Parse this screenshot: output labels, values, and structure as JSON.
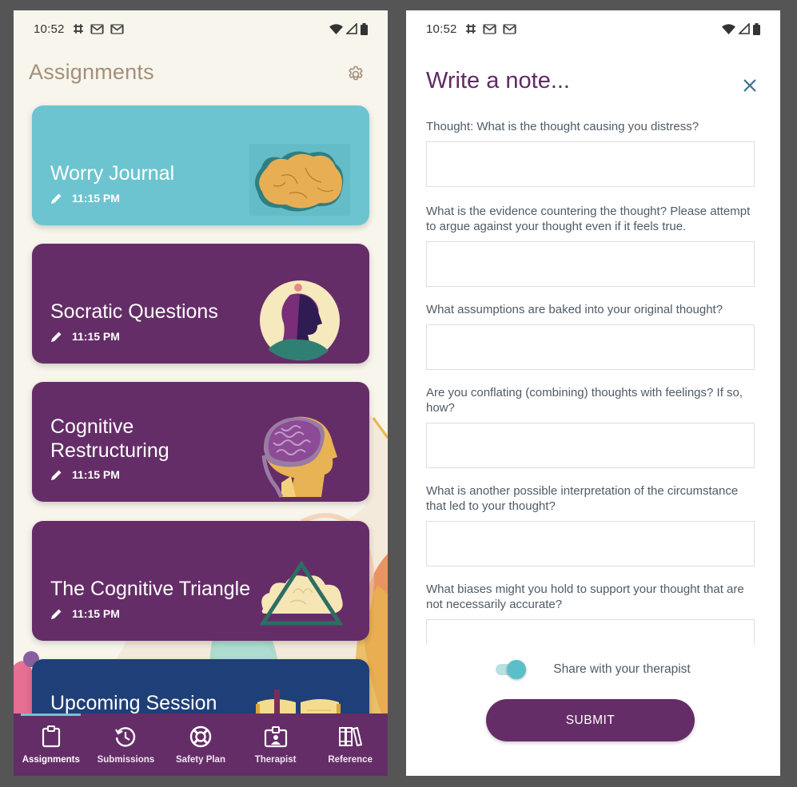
{
  "status_bar": {
    "time": "10:52",
    "notification_icons": [
      "slack-icon",
      "gmail-icon",
      "gmail-icon"
    ],
    "system_icons": [
      "wifi-icon",
      "cell-signal-icon",
      "battery-icon"
    ]
  },
  "assignments_screen": {
    "title": "Assignments",
    "settings_icon": "gear-icon",
    "cards": [
      {
        "title": "Worry Journal",
        "time": "11:15 PM",
        "icon": "pencil-icon",
        "illustration": "brain-cloud",
        "color": "#6cc4d0"
      },
      {
        "title": "Socratic Questions",
        "time": "11:15 PM",
        "icon": "pencil-icon",
        "illustration": "head-silhouette",
        "color": "#652d68"
      },
      {
        "title": "Cognitive Restructuring",
        "title_lines": [
          "Cognitive",
          "Restructuring"
        ],
        "time": "11:15 PM",
        "icon": "pencil-icon",
        "illustration": "brain-head",
        "color": "#652d68"
      },
      {
        "title": "The Cognitive Triangle",
        "time": "11:15 PM",
        "icon": "pencil-icon",
        "illustration": "triangle-cloud",
        "color": "#652d68"
      },
      {
        "title": "Upcoming Session",
        "illustration": "open-book",
        "color": "#1f3f78"
      }
    ],
    "bottom_nav": {
      "active": "Assignments",
      "items": [
        {
          "label": "Assignments",
          "icon": "clipboard-icon"
        },
        {
          "label": "Submissions",
          "icon": "history-icon"
        },
        {
          "label": "Safety Plan",
          "icon": "lifebuoy-icon"
        },
        {
          "label": "Therapist",
          "icon": "id-badge-icon"
        },
        {
          "label": "Reference",
          "icon": "books-icon"
        }
      ]
    }
  },
  "note_screen": {
    "title": "Write a note...",
    "close_icon": "close-icon",
    "questions": [
      {
        "label": "Thought: What is the thought causing you distress?",
        "value": "",
        "placeholder": ""
      },
      {
        "label": "What is the evidence countering the thought? Please attempt to argue against your thought even if it feels true.",
        "value": "",
        "placeholder": ""
      },
      {
        "label": "What assumptions are baked into your original thought?",
        "value": "",
        "placeholder": ""
      },
      {
        "label": "Are you conflating (combining) thoughts with feelings? If so, how?",
        "value": "",
        "placeholder": ""
      },
      {
        "label": "What is another possible interpretation of the circumstance that led to your thought?",
        "value": "",
        "placeholder": ""
      },
      {
        "label": "What biases might you hold to support your thought that are not necessarily accurate?",
        "value": "",
        "placeholder": ""
      }
    ],
    "share_toggle": {
      "label": "Share with your therapist",
      "checked": true
    },
    "submit_label": "SUBMIT"
  },
  "colors": {
    "brand_purple": "#652d68",
    "teal": "#6cc4d0",
    "navy": "#1f3f78",
    "cream_bg": "#f8f5ec",
    "title_tan": "#a38f7b"
  }
}
